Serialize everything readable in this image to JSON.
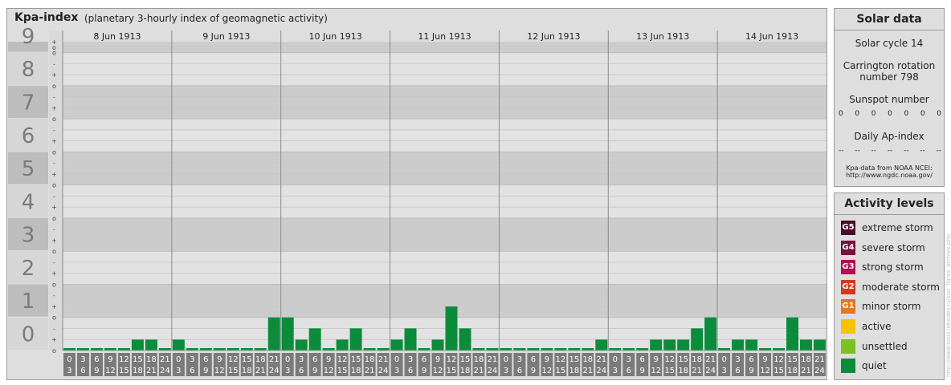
{
  "header": {
    "title": "Kpa-index",
    "subtitle": "(planetary 3-hourly index of geomagnetic activity)"
  },
  "chart_data": {
    "type": "bar",
    "y_levels": [
      "0",
      "1",
      "2",
      "3",
      "4",
      "5",
      "6",
      "7",
      "8",
      "9"
    ],
    "sub_ticks": [
      "o",
      "+",
      "-",
      "o"
    ],
    "ylim": [
      0,
      9.33
    ],
    "days": [
      "8 Jun 1913",
      "9 Jun 1913",
      "10 Jun 1913",
      "11 Jun 1913",
      "12 Jun 1913",
      "13 Jun 1913",
      "14 Jun 1913"
    ],
    "interval_start": [
      "0",
      "3",
      "6",
      "9",
      "12",
      "15",
      "18",
      "21"
    ],
    "interval_end": [
      "3",
      "6",
      "9",
      "12",
      "15",
      "18",
      "21",
      "24"
    ],
    "values": [
      [
        0,
        0,
        0,
        0,
        0,
        0.33,
        0.33,
        0
      ],
      [
        0.33,
        0,
        0,
        0,
        0,
        0,
        0,
        1
      ],
      [
        1,
        0.33,
        0.67,
        0,
        0.33,
        0.67,
        0,
        0
      ],
      [
        0.33,
        0.67,
        0,
        0.33,
        1.33,
        0.67,
        0,
        0
      ],
      [
        0,
        0,
        0,
        0,
        0,
        0,
        0,
        0.33
      ],
      [
        0,
        0,
        0,
        0.33,
        0.33,
        0.33,
        0.67,
        1
      ],
      [
        0,
        0.33,
        0.33,
        0,
        0,
        1,
        0.33,
        0.33
      ]
    ],
    "bar_color": "#0b8c3b"
  },
  "solar": {
    "title": "Solar data",
    "cycle": "Solar cycle 14",
    "carrington_1": "Carrington rotation",
    "carrington_2": "number 798",
    "sunspot_label": "Sunspot number",
    "sunspot_values": [
      "0",
      "0",
      "0",
      "0",
      "0",
      "0",
      "0"
    ],
    "ap_label": "Daily Ap-index",
    "ap_values": [
      "--",
      "--",
      "--",
      "--",
      "--",
      "--",
      "--"
    ],
    "source_1": "Kpa-data from NOAA NCEI:",
    "source_2": "http://www.ngdc.noaa.gov/"
  },
  "activity": {
    "title": "Activity levels",
    "levels": [
      {
        "badge": "G5",
        "label": "extreme storm",
        "color": "#4a0b2e"
      },
      {
        "badge": "G4",
        "label": "severe storm",
        "color": "#7a1040"
      },
      {
        "badge": "G3",
        "label": "strong storm",
        "color": "#b01050"
      },
      {
        "badge": "G2",
        "label": "moderate storm",
        "color": "#d4391c"
      },
      {
        "badge": "G1",
        "label": "minor storm",
        "color": "#e07a1a"
      },
      {
        "badge": "",
        "label": "active",
        "color": "#f5c400"
      },
      {
        "badge": "",
        "label": "unsettled",
        "color": "#7cc024"
      },
      {
        "badge": "",
        "label": "quiet",
        "color": "#0b8c3b"
      }
    ]
  },
  "watermark": "http://www.tesis.lebedev.ru/sun_flares_archive.php"
}
